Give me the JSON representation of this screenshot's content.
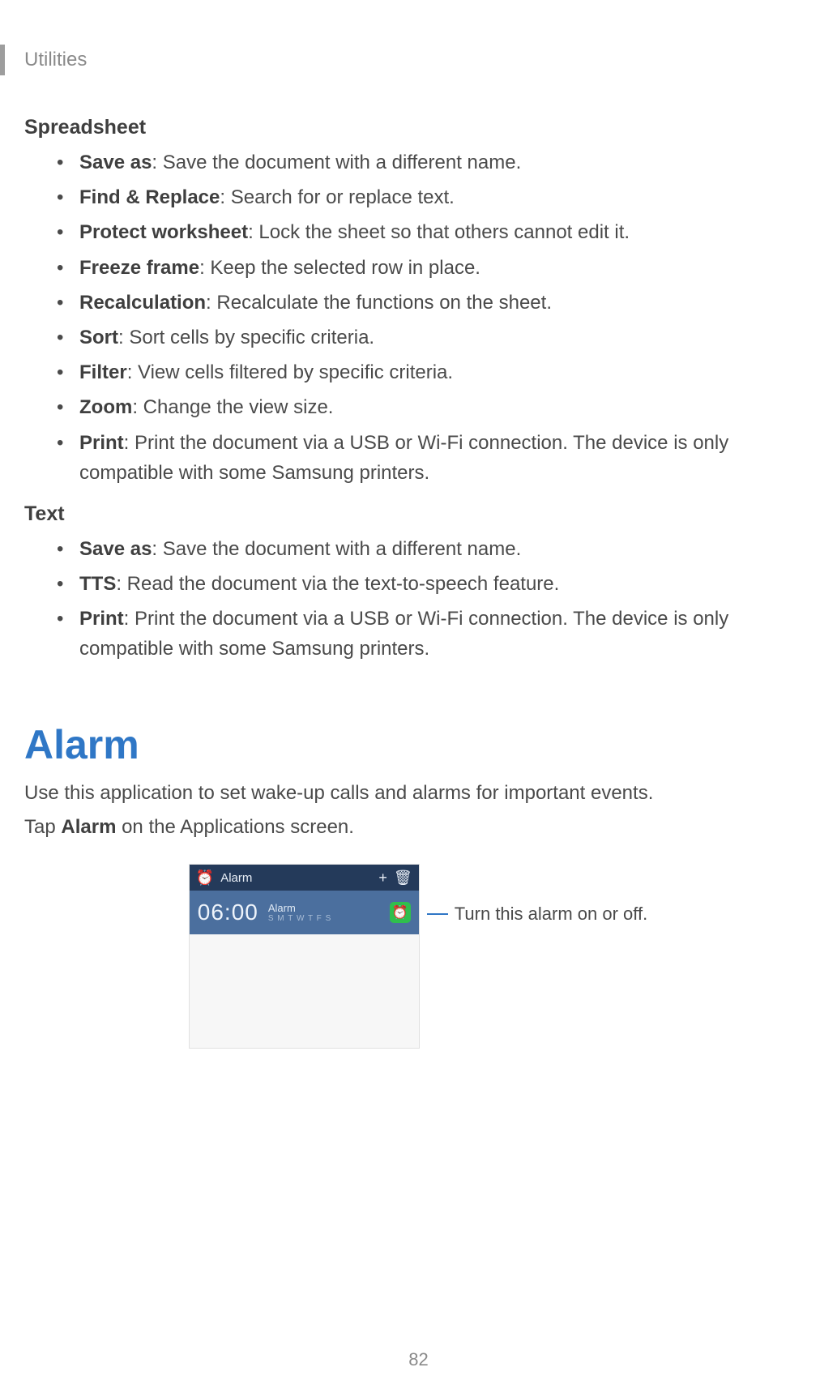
{
  "running_head": "Utilities",
  "page_number": "82",
  "spreadsheet_heading": "Spreadsheet",
  "spreadsheet_items": [
    {
      "term": "Save as",
      "desc": ": Save the document with a different name."
    },
    {
      "term": "Find & Replace",
      "desc": ": Search for or replace text."
    },
    {
      "term": "Protect worksheet",
      "desc": ": Lock the sheet so that others cannot edit it."
    },
    {
      "term": "Freeze frame",
      "desc": ": Keep the selected row in place."
    },
    {
      "term": "Recalculation",
      "desc": ": Recalculate the functions on the sheet."
    },
    {
      "term": "Sort",
      "desc": ": Sort cells by specific criteria."
    },
    {
      "term": "Filter",
      "desc": ": View cells filtered by specific criteria."
    },
    {
      "term": "Zoom",
      "desc": ": Change the view size."
    },
    {
      "term": "Print",
      "desc": ": Print the document via a USB or Wi-Fi connection. The device is only compatible with some Samsung printers."
    }
  ],
  "text_heading": "Text",
  "text_items": [
    {
      "term": "Save as",
      "desc": ": Save the document with a different name."
    },
    {
      "term": "TTS",
      "desc": ": Read the document via the text-to-speech feature."
    },
    {
      "term": "Print",
      "desc": ": Print the document via a USB or Wi-Fi connection. The device is only compatible with some Samsung printers."
    }
  ],
  "alarm": {
    "heading": "Alarm",
    "intro": "Use this application to set wake-up calls and alarms for important events.",
    "tap_pre": "Tap ",
    "tap_strong": "Alarm",
    "tap_post": " on the Applications screen.",
    "callout": "Turn this alarm on or off.",
    "screenshot": {
      "header_title": "Alarm",
      "add_icon": "+",
      "delete_icon": "🗑",
      "clock_icon": "⏰",
      "time": "06:00",
      "label": "Alarm",
      "days": "S M T W T F S",
      "toggle_icon": "⏰"
    }
  }
}
